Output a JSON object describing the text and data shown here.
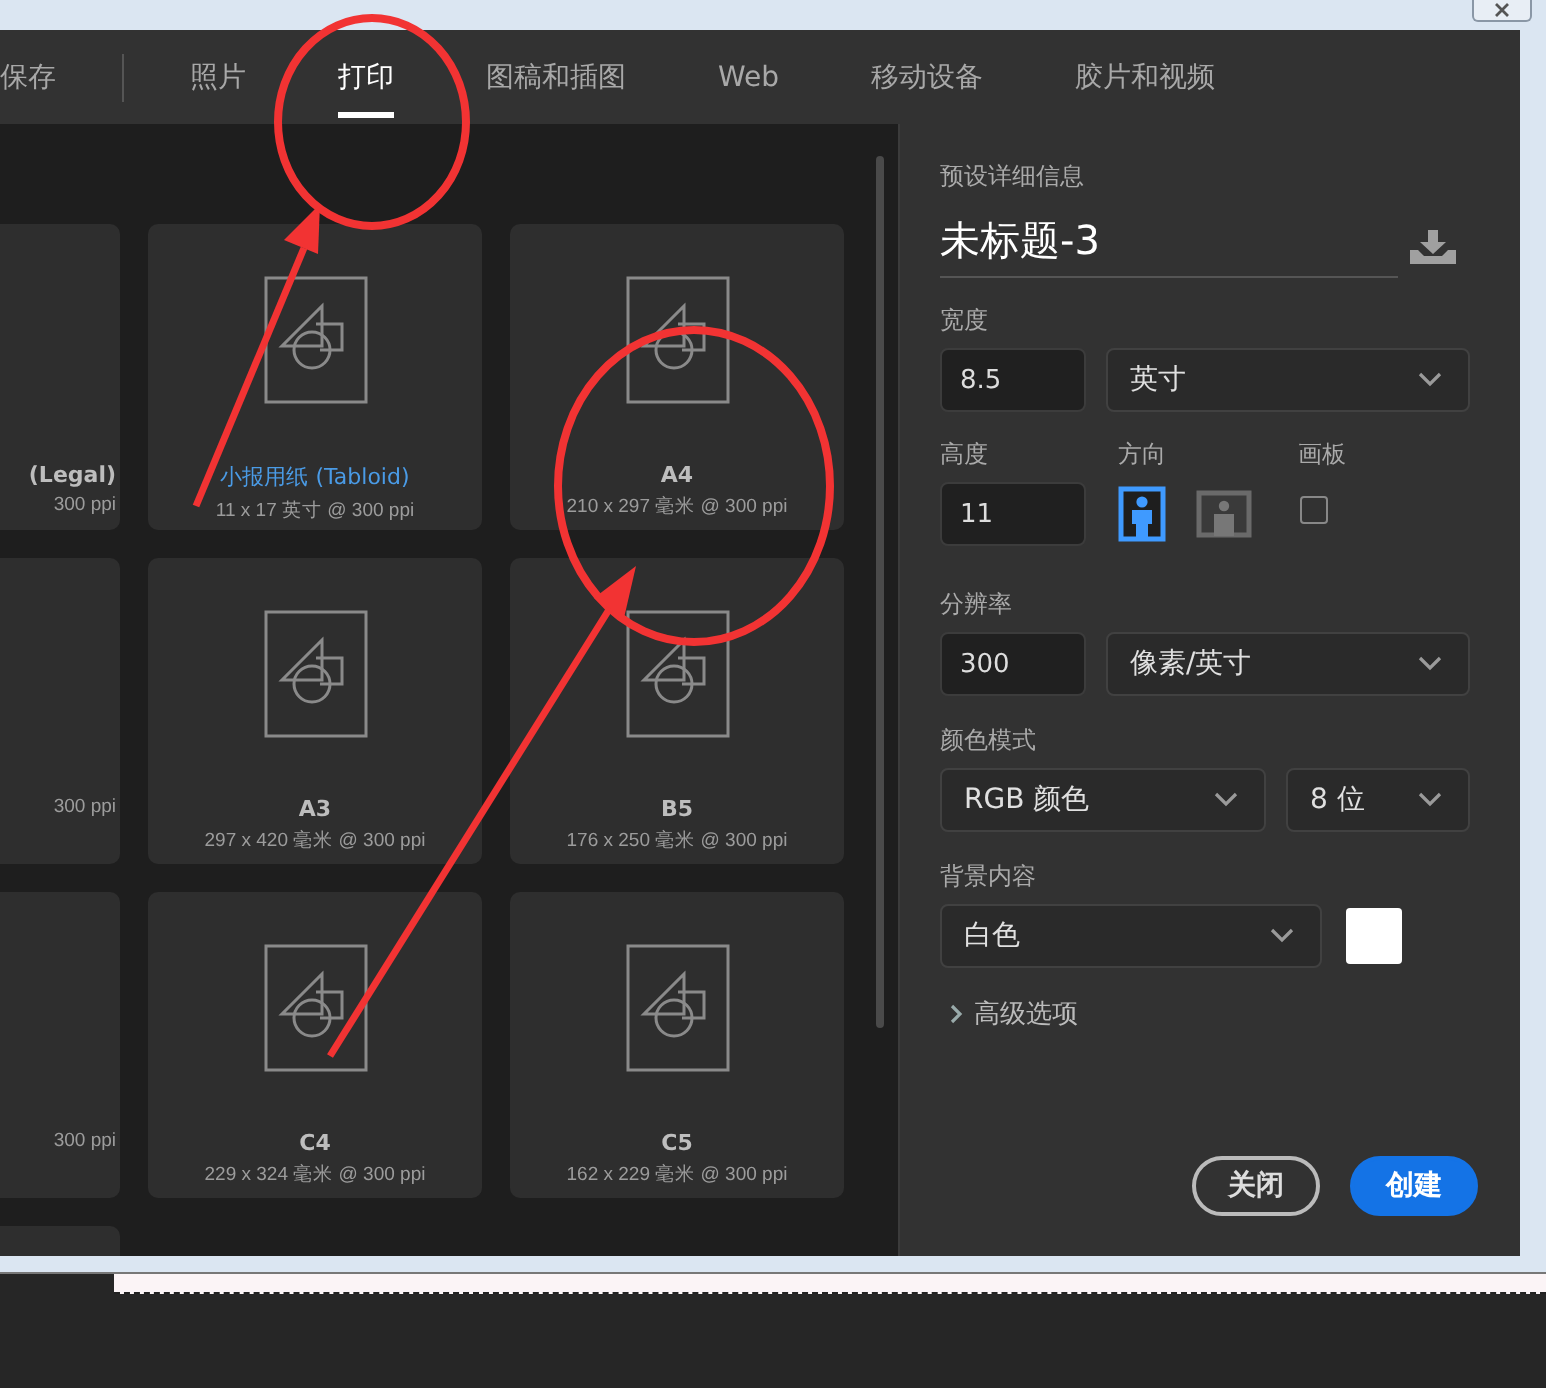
{
  "tabs": [
    {
      "label": "保存",
      "selected": false,
      "divider_after": true
    },
    {
      "label": "照片",
      "selected": false,
      "divider_after": false
    },
    {
      "label": "打印",
      "selected": true,
      "divider_after": false
    },
    {
      "label": "图稿和插图",
      "selected": false,
      "divider_after": false
    },
    {
      "label": "Web",
      "selected": false,
      "divider_after": false
    },
    {
      "label": "移动设备",
      "selected": false,
      "divider_after": false
    },
    {
      "label": "胶片和视频",
      "selected": false,
      "divider_after": false
    }
  ],
  "presets": [
    {
      "kind": "partial",
      "name": "(Legal)",
      "size": "300 ppi",
      "selected": false
    },
    {
      "kind": "full",
      "name": "小报用纸 (Tabloid)",
      "size": "11 x 17 英寸 @ 300 ppi",
      "selected": true
    },
    {
      "kind": "full",
      "name": "A4",
      "size": "210 x 297 毫米 @ 300 ppi",
      "selected": false
    },
    {
      "kind": "partial",
      "size": "300 ppi",
      "selected": false
    },
    {
      "kind": "full",
      "name": "A3",
      "size": "297 x 420 毫米 @ 300 ppi",
      "selected": false
    },
    {
      "kind": "full",
      "name": "B5",
      "size": "176 x 250 毫米 @ 300 ppi",
      "selected": false
    },
    {
      "kind": "partial",
      "size": "300 ppi",
      "selected": false
    },
    {
      "kind": "full",
      "name": "C4",
      "size": "229 x 324 毫米 @ 300 ppi",
      "selected": false
    },
    {
      "kind": "full",
      "name": "C5",
      "size": "162 x 229 毫米 @ 300 ppi",
      "selected": false
    },
    {
      "kind": "partial",
      "selected": false
    }
  ],
  "details": {
    "heading": "预设详细信息",
    "name": "未标题-3",
    "width": {
      "label": "宽度",
      "value": "8.5",
      "unit": "英寸"
    },
    "height": {
      "label": "高度",
      "value": "11"
    },
    "orientation": {
      "label": "方向",
      "options": [
        {
          "kind": "portrait",
          "selected": true
        },
        {
          "kind": "landscape",
          "selected": false
        }
      ]
    },
    "artboard": {
      "label": "画板",
      "checked": false
    },
    "resolution": {
      "label": "分辨率",
      "value": "300",
      "unit": "像素/英寸"
    },
    "color_mode": {
      "label": "颜色模式",
      "mode": "RGB 颜色",
      "depth": "8 位"
    },
    "background": {
      "label": "背景内容",
      "value": "白色",
      "color": "#ffffff"
    },
    "advanced": {
      "label": "高级选项",
      "expanded": false
    }
  },
  "buttons": [
    {
      "label": "关闭",
      "kind": "secondary"
    },
    {
      "label": "创建",
      "kind": "primary"
    }
  ]
}
